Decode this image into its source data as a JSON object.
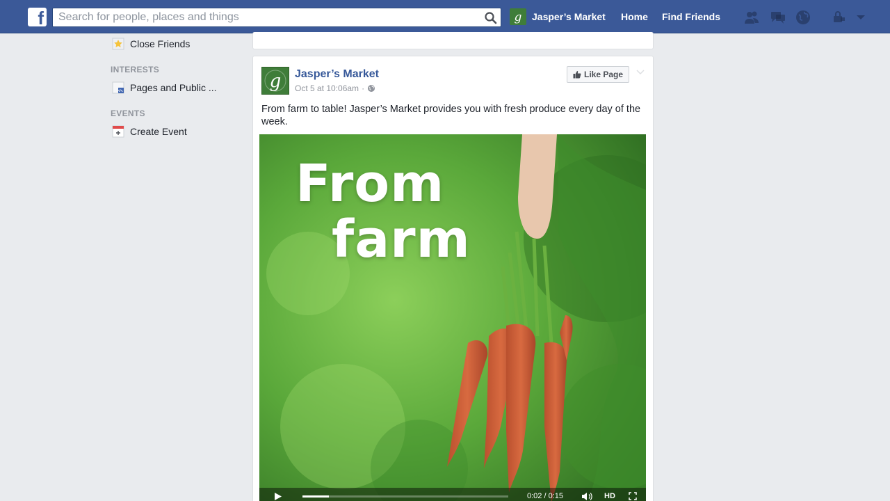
{
  "topbar": {
    "search_placeholder": "Search for people, places and things",
    "page_name": "Jasper’s Market",
    "home": "Home",
    "find_friends": "Find Friends"
  },
  "sidebar": {
    "close_friends": "Close Friends",
    "interests_header": "INTERESTS",
    "pages_public": "Pages and Public ...",
    "events_header": "EVENTS",
    "create_event": "Create Event"
  },
  "post": {
    "page_name": "Jasper’s Market",
    "timestamp": "Oct 5 at 10:06am",
    "separator": "·",
    "like_page_label": "Like Page",
    "text": "From farm to table! Jasper’s Market provides you with fresh produce every day of the week.",
    "video": {
      "overlay_line1": "From",
      "overlay_line2": "farm",
      "time": "0:02 / 0:15",
      "hd": "HD",
      "progress": 0.13
    }
  },
  "colors": {
    "facebook_blue": "#3b5998",
    "link_blue": "#365899",
    "brand_green": "#3f7d39",
    "background": "#e9ebee"
  }
}
